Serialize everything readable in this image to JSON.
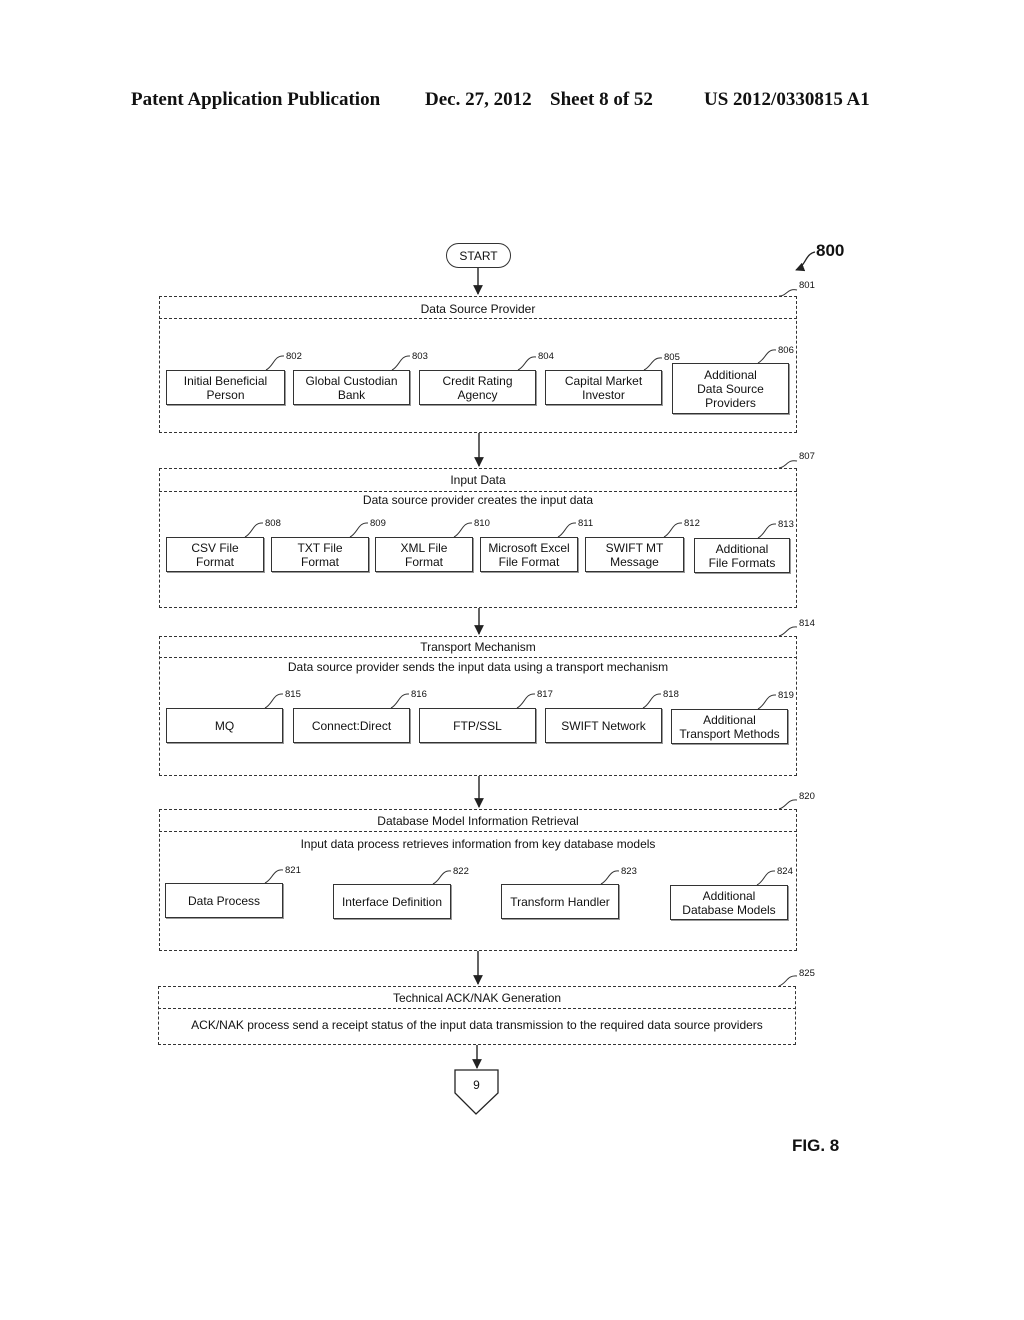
{
  "header": {
    "publication": "Patent Application Publication",
    "date": "Dec. 27, 2012",
    "sheet": "Sheet 8 of 52",
    "pub_number": "US 2012/0330815 A1"
  },
  "figure": {
    "ref": "800",
    "label": "FIG. 8",
    "start_label": "START",
    "offpage_connector": "9"
  },
  "sections": [
    {
      "ref": "801",
      "title": "Data Source Provider",
      "description": "",
      "boxes": [
        {
          "ref": "802",
          "label": "Initial Beneficial\nPerson"
        },
        {
          "ref": "803",
          "label": "Global Custodian\nBank"
        },
        {
          "ref": "804",
          "label": "Credit Rating\nAgency"
        },
        {
          "ref": "805",
          "label": "Capital Market\nInvestor"
        },
        {
          "ref": "806",
          "label": "Additional\nData Source\nProviders"
        }
      ]
    },
    {
      "ref": "807",
      "title": "Input Data",
      "description": "Data source provider creates the input data",
      "boxes": [
        {
          "ref": "808",
          "label": "CSV File\nFormat"
        },
        {
          "ref": "809",
          "label": "TXT File\nFormat"
        },
        {
          "ref": "810",
          "label": "XML File\nFormat"
        },
        {
          "ref": "811",
          "label": "Microsoft Excel\nFile Format"
        },
        {
          "ref": "812",
          "label": "SWIFT MT\nMessage"
        },
        {
          "ref": "813",
          "label": "Additional\nFile Formats"
        }
      ]
    },
    {
      "ref": "814",
      "title": "Transport Mechanism",
      "description": "Data source provider sends the input data using a transport mechanism",
      "boxes": [
        {
          "ref": "815",
          "label": "MQ"
        },
        {
          "ref": "816",
          "label": "Connect:Direct"
        },
        {
          "ref": "817",
          "label": "FTP/SSL"
        },
        {
          "ref": "818",
          "label": "SWIFT Network"
        },
        {
          "ref": "819",
          "label": "Additional\nTransport Methods"
        }
      ]
    },
    {
      "ref": "820",
      "title": "Database Model Information Retrieval",
      "description": "Input data process retrieves information from key database models",
      "boxes": [
        {
          "ref": "821",
          "label": "Data Process"
        },
        {
          "ref": "822",
          "label": "Interface Definition"
        },
        {
          "ref": "823",
          "label": "Transform Handler"
        },
        {
          "ref": "824",
          "label": "Additional\nDatabase Models"
        }
      ]
    },
    {
      "ref": "825",
      "title": "Technical ACK/NAK Generation",
      "description": "ACK/NAK process send a receipt status of the input data transmission to the required data source providers",
      "boxes": []
    }
  ]
}
